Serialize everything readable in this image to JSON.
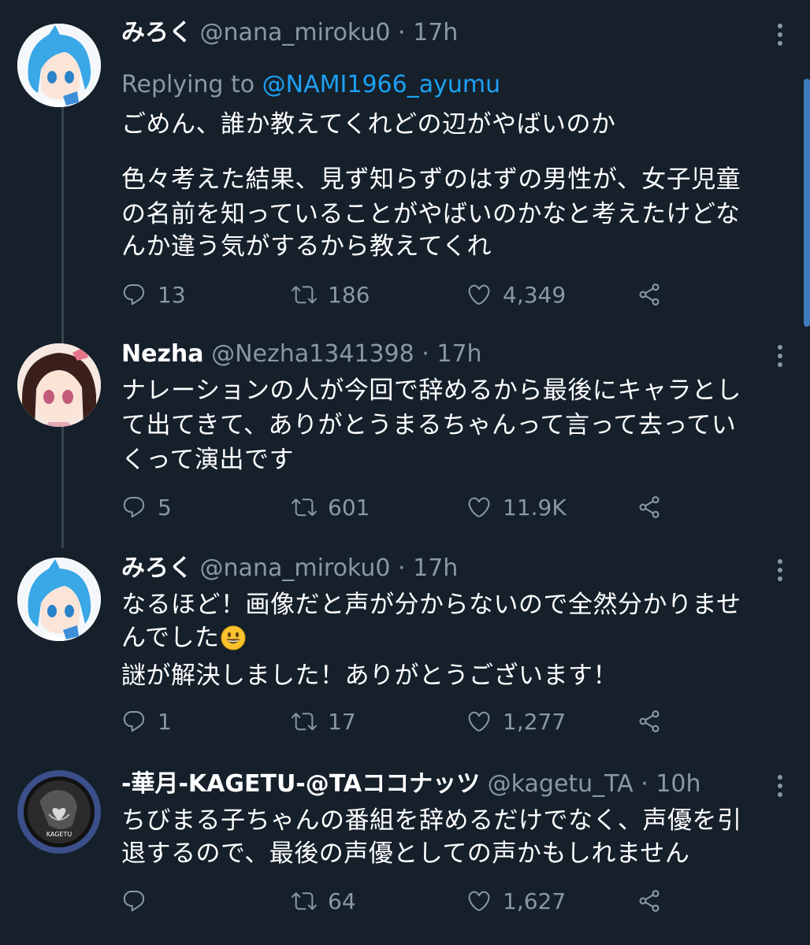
{
  "colors": {
    "background": "#15202b",
    "text_primary": "#ffffff",
    "text_secondary": "#8899a6",
    "link": "#1da1f2",
    "thread_line": "#38444d"
  },
  "icons": {
    "reply": "reply-icon",
    "retweet": "retweet-icon",
    "like": "heart-icon",
    "share": "share-icon",
    "more": "more-vertical-icon"
  },
  "tweets": [
    {
      "display_name": "みろく",
      "handle": "@nana_miroku0",
      "separator": "·",
      "time": "17h",
      "reply_prefix": "Replying to ",
      "reply_to": "@NAMI1966_ayumu",
      "text_lines": [
        "ごめん、誰か教えてくれどの辺がやばいのか",
        "",
        "色々考えた結果、見ず知らずのはずの男性が、女子児童",
        "の名前を知っていることがやばいのかなと考えたけどな",
        "んか違う気がするから教えてくれ"
      ],
      "replies": "13",
      "retweets": "186",
      "likes": "4,349"
    },
    {
      "display_name": "Nezha",
      "handle": "@Nezha1341398",
      "separator": "·",
      "time": "17h",
      "text_lines": [
        "ナレーションの人が今回で辞めるから最後にキャラとし",
        "て出てきて、ありがとうまるちゃんって言って去ってい",
        "くって演出です"
      ],
      "replies": "5",
      "retweets": "601",
      "likes": "11.9K"
    },
    {
      "display_name": "みろく",
      "handle": "@nana_miroku0",
      "separator": "·",
      "time": "17h",
      "text_lines": [
        "なるほど！画像だと声が分からないので全然分かりませ",
        "んでした",
        "謎が解決しました！ありがとうございます！"
      ],
      "emoji": "grinning-face-emoji",
      "replies": "1",
      "retweets": "17",
      "likes": "1,277"
    },
    {
      "display_name": "-華月-KAGETU-@TAココナッツ",
      "handle": "@kagetu_TA",
      "separator": "·",
      "time": "10h",
      "avatar_text": "KAGETU",
      "text_lines": [
        "ちびまる子ちゃんの番組を辞めるだけでなく、声優を引",
        "退するので、最後の声優としての声かもしれません"
      ],
      "replies": "",
      "retweets": "64",
      "likes": "1,627"
    }
  ]
}
